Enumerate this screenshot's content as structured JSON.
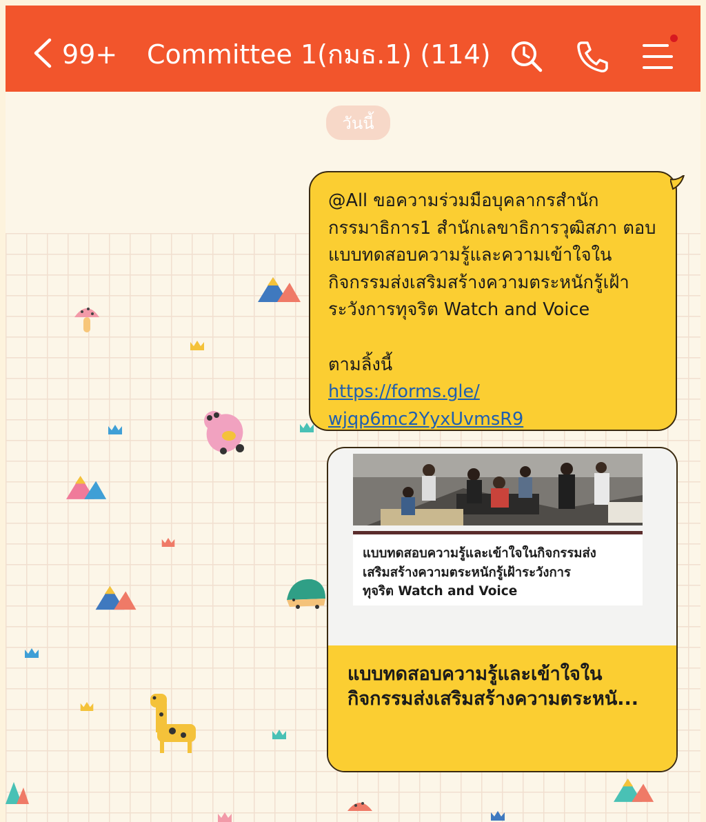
{
  "header": {
    "back_count": "99+",
    "chat_title": "Committee 1(กมธ.1) (114)",
    "accent_color": "#f2552c",
    "icons": [
      "back-chevron-icon",
      "search-icon",
      "phone-icon",
      "menu-icon"
    ]
  },
  "date_label": "วันนี้",
  "message": {
    "line1": "@All ขอความร่วมมือบุคลากรสำนัก",
    "line2": "กรรมาธิการ1 สำนักเลขาธิการวุฒิสภา ตอบ",
    "line3": "แบบทดสอบความรู้และความเข้าใจใน",
    "line4": "กิจกรรมส่งเสริมสร้างความตระหนักรู้เฝ้า",
    "line5": "ระวังการทุจริต Watch and Voice",
    "follow_label": "ตามลิ้งนี้",
    "link_line1": "https://forms.gle/",
    "link_line2": "wjqp6mc2YyxUvmsR9",
    "bubble_color": "#fbce32"
  },
  "preview": {
    "inner_line1": "แบบทดสอบความรู้และเข้าใจในกิจกรรมส่ง",
    "inner_line2": "เสริมสร้างความตระหนักรู้เฝ้าระวังการ",
    "inner_line3": "ทุจริต Watch and Voice",
    "caption_line1": "แบบทดสอบความรู้และเข้าใจใน",
    "caption_line2": "กิจกรรมส่งเสริมสร้างความตระหนั..."
  }
}
